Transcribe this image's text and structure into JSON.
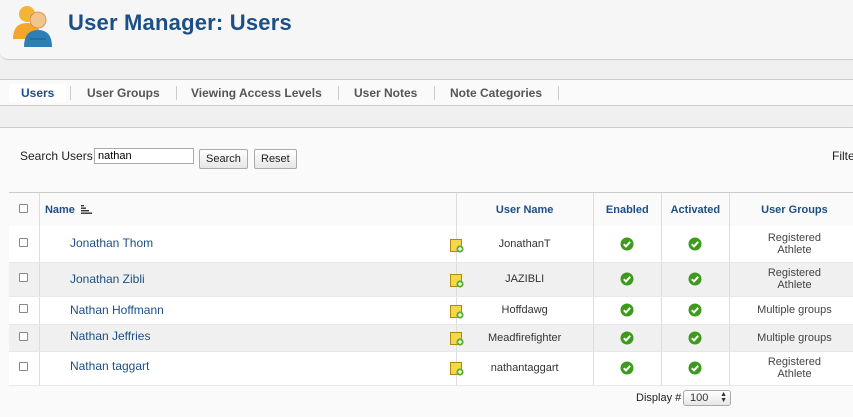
{
  "header": {
    "title": "User Manager: Users"
  },
  "tabs": [
    {
      "label": "Users",
      "active": true
    },
    {
      "label": "User Groups",
      "active": false
    },
    {
      "label": "Viewing Access Levels",
      "active": false
    },
    {
      "label": "User Notes",
      "active": false
    },
    {
      "label": "Note Categories",
      "active": false
    }
  ],
  "search": {
    "label": "Search Users",
    "value": "nathan",
    "search_button": "Search",
    "reset_button": "Reset",
    "filter_label": "Filte"
  },
  "table": {
    "columns": [
      "Name",
      "User Name",
      "Enabled",
      "Activated",
      "User Groups"
    ],
    "rows": [
      {
        "name": "Jonathan Thom",
        "username": "JonathanT",
        "groups": [
          "Registered",
          "Athlete"
        ]
      },
      {
        "name": "Jonathan Zibli",
        "username": "JAZIBLI",
        "groups": [
          "Registered",
          "Athlete"
        ]
      },
      {
        "name": "Nathan Hoffmann",
        "username": "Hoffdawg",
        "groups": [
          "Multiple groups"
        ]
      },
      {
        "name": "Nathan Jeffries",
        "username": "Meadfirefighter",
        "groups": [
          "Multiple groups"
        ]
      },
      {
        "name": "Nathan taggart",
        "username": "nathantaggart",
        "groups": [
          "Registered",
          "Athlete"
        ]
      }
    ]
  },
  "pagination": {
    "display_label": "Display #",
    "display_value": "100"
  },
  "colors": {
    "title": "#1c4f85",
    "check_green": "#3d9a1c",
    "note_yellow": "#f6d64a"
  }
}
